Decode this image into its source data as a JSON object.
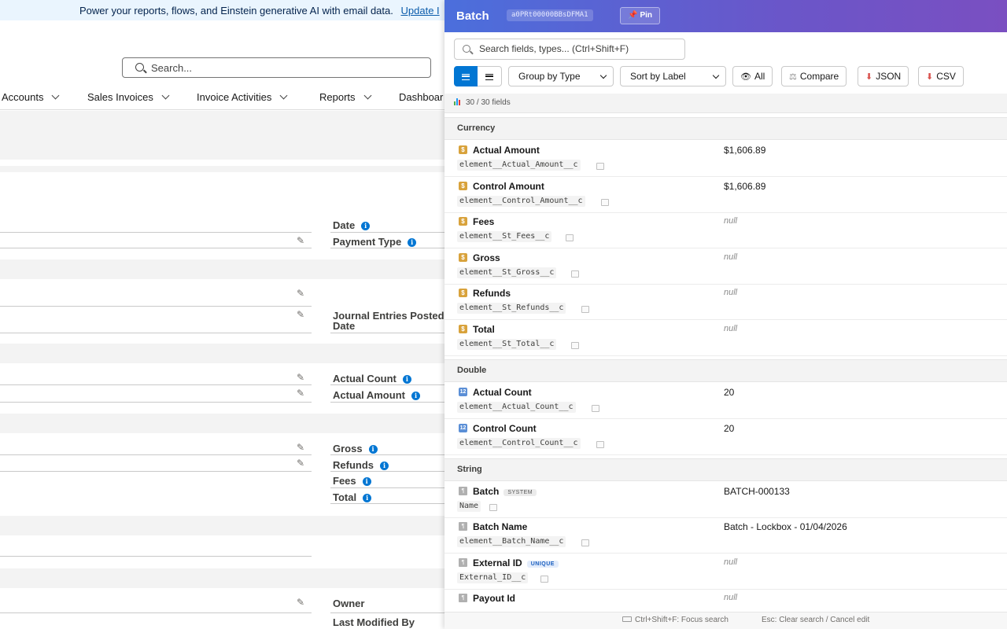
{
  "background": {
    "banner": {
      "text": "Power your reports, flows, and Einstein generative AI with email data.",
      "link": "Update I"
    },
    "search": {
      "placeholder": "Search..."
    },
    "nav": [
      "Accounts",
      "Sales Invoices",
      "Invoice Activities",
      "Reports",
      "Dashboar"
    ],
    "labels": {
      "date": "Date",
      "payment_type": "Payment Type",
      "journal_entries": "Journal Entries Posted",
      "journal_entries_2": "Date",
      "actual_count": "Actual Count",
      "actual_amount": "Actual Amount",
      "gross": "Gross",
      "refunds": "Refunds",
      "fees": "Fees",
      "total": "Total",
      "owner": "Owner",
      "last_modified": "Last Modified By"
    }
  },
  "panel": {
    "title": "Batch",
    "record_id": "a0PRt00000BBsDFMA1",
    "pin_label": "Pin",
    "search_placeholder": "Search fields, types... (Ctrl+Shift+F)",
    "group_select": "Group by Type",
    "sort_select": "Sort by Label",
    "buttons": {
      "all": "All",
      "compare": "Compare",
      "json": "JSON",
      "csv": "CSV"
    },
    "field_count": "30 / 30 fields",
    "groups": [
      {
        "name": "Currency",
        "fields": [
          {
            "label": "Actual Amount",
            "api": "element__Actual_Amount__c",
            "value": "$1,606.89"
          },
          {
            "label": "Control Amount",
            "api": "element__Control_Amount__c",
            "value": "$1,606.89"
          },
          {
            "label": "Fees",
            "api": "element__St_Fees__c",
            "value": "null"
          },
          {
            "label": "Gross",
            "api": "element__St_Gross__c",
            "value": "null"
          },
          {
            "label": "Refunds",
            "api": "element__St_Refunds__c",
            "value": "null"
          },
          {
            "label": "Total",
            "api": "element__St_Total__c",
            "value": "null"
          }
        ]
      },
      {
        "name": "Double",
        "fields": [
          {
            "label": "Actual Count",
            "api": "element__Actual_Count__c",
            "value": "20"
          },
          {
            "label": "Control Count",
            "api": "element__Control_Count__c",
            "value": "20"
          }
        ]
      },
      {
        "name": "String",
        "fields": [
          {
            "label": "Batch",
            "badge": "SYSTEM",
            "api": "Name",
            "value": "BATCH-000133"
          },
          {
            "label": "Batch Name",
            "api": "element__Batch_Name__c",
            "value": "Batch - Lockbox - 01/04/2026"
          },
          {
            "label": "External ID",
            "badge": "UNIQUE",
            "api": "External_ID__c",
            "value": "null"
          },
          {
            "label": "Payout Id",
            "api": "",
            "value": "null"
          }
        ]
      }
    ],
    "footer": {
      "left": "Ctrl+Shift+F: Focus search",
      "right": "Esc: Clear search / Cancel edit"
    },
    "colors": {
      "header_start": "#4b6fdc",
      "header_end": "#7a4fc1",
      "accent": "#0176d3"
    }
  }
}
